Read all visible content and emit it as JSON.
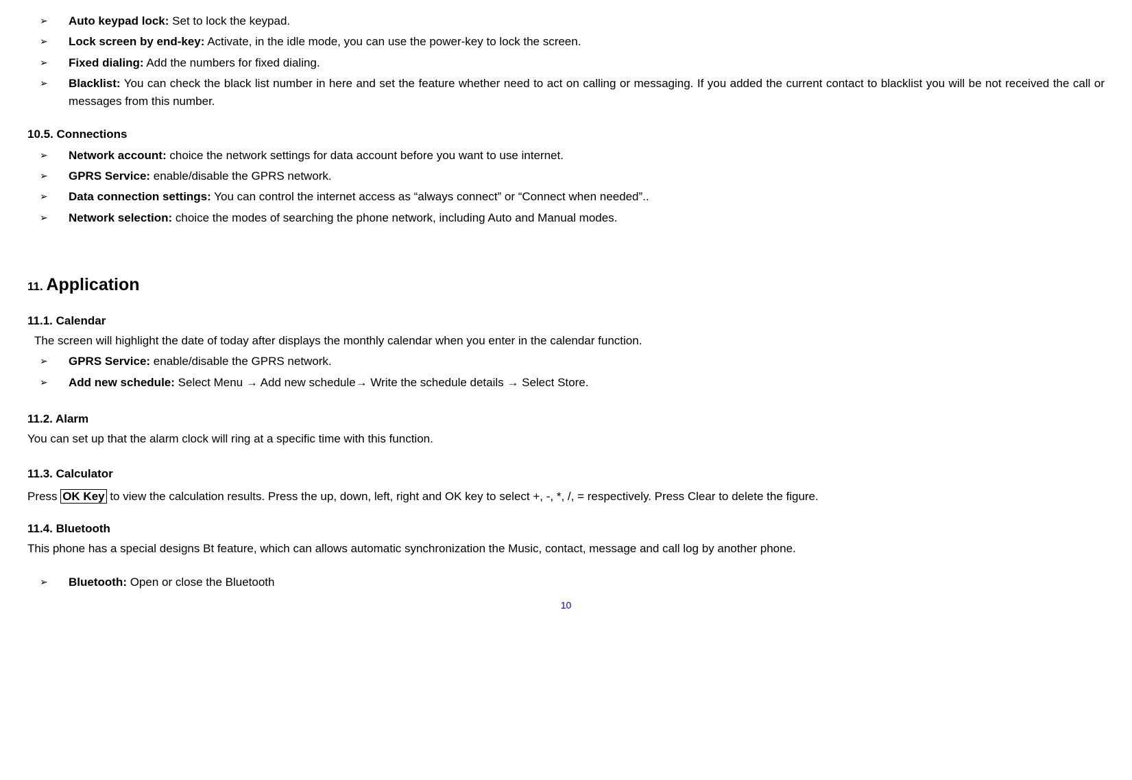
{
  "top_bullets": [
    {
      "term": "Auto keypad lock:",
      "desc": " Set to lock the keypad."
    },
    {
      "term": "Lock screen by end-key:",
      "desc": " Activate, in the idle mode, you can use the power-key to lock the screen."
    },
    {
      "term": "Fixed dialing:",
      "desc": " Add the numbers for fixed dialing."
    },
    {
      "term": "Blacklist:",
      "desc": " You can check the black list number in here and set the feature whether need to act on calling or messaging. If you added the current contact to blacklist you will be not received the call or messages from this number."
    }
  ],
  "sec_105": {
    "title": "10.5.  Connections",
    "bullets": [
      {
        "term": "Network account:",
        "desc": " choice the network settings for data account before you want to use internet."
      },
      {
        "term": "GPRS Service:",
        "desc": " enable/disable the GPRS network."
      },
      {
        "term": "Data connection settings:",
        "desc": " You can control the internet access as “always connect” or “Connect when needed”.."
      },
      {
        "term": "Network selection:",
        "desc": " choice the modes of searching the phone network, including Auto and Manual modes."
      }
    ]
  },
  "sec_11": {
    "num": "11. ",
    "title": "Application"
  },
  "sec_111": {
    "title": "11.1. Calendar",
    "intro": "The screen will highlight the date of today after displays the monthly calendar when you enter in the calendar function.",
    "bullets": [
      {
        "term": "GPRS Service:",
        "desc": " enable/disable the GPRS network."
      }
    ],
    "schedule": {
      "term": "Add new schedule:",
      "p1": " Select Menu ",
      "a1": "→",
      "p2": " Add new schedule",
      "a2": "→",
      "p3": " Write the schedule details ",
      "a3": "→",
      "p4": " Select Store."
    }
  },
  "sec_112": {
    "title": "11.2. Alarm",
    "body": "You can set up that the alarm clock will ring at a specific time with this function."
  },
  "sec_113": {
    "title": "11.3. Calculator",
    "pre": "Press ",
    "ok": "OK Key",
    "post": " to view the calculation results. Press the up, down, left, right and OK key to select +, -, *, /, = respectively. Press Clear to delete the figure."
  },
  "sec_114": {
    "title": "11.4.  Bluetooth",
    "body": "This phone has a special designs Bt feature, which can allows automatic synchronization the Music, contact, message and call log by another phone.",
    "bullet": {
      "term": "Bluetooth:",
      "desc": " Open or close the Bluetooth"
    }
  },
  "page_number": "10",
  "glyphs": {
    "bullet": "➢"
  }
}
